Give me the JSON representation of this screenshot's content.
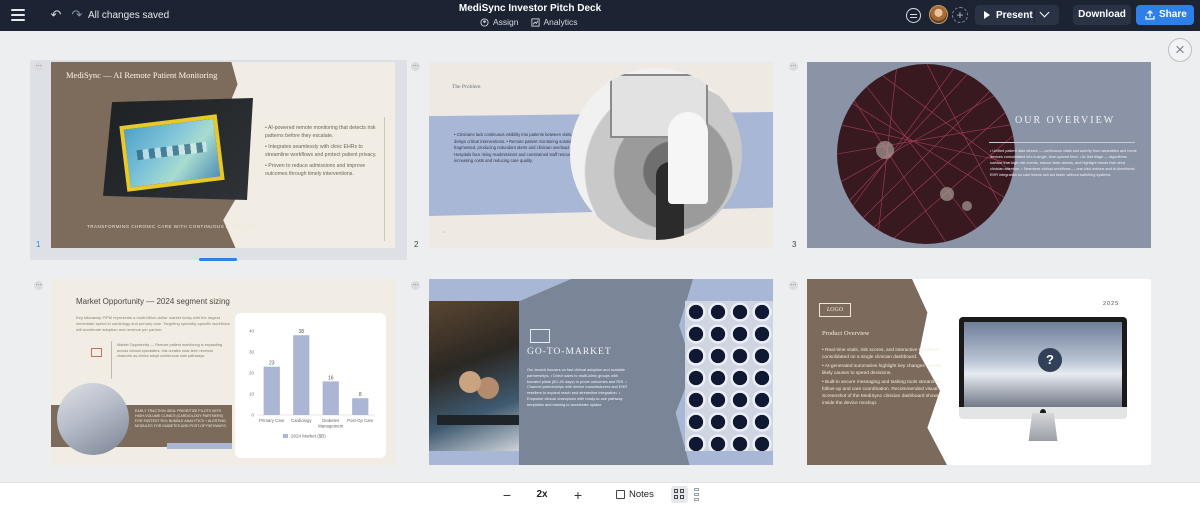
{
  "topbar": {
    "saved_status": "All changes saved",
    "title": "MediSync Investor Pitch Deck",
    "assign_label": "Assign",
    "analytics_label": "Analytics",
    "present_label": "Present",
    "download_label": "Download",
    "share_label": "Share",
    "share_color": "#2f7fe8",
    "bar_color": "#1c2433"
  },
  "close_icon": "×",
  "slides": [
    {
      "number": "1",
      "title": "MediSync — AI Remote Patient Monitoring",
      "bullets": [
        "• AI-powered remote monitoring that detects risk patterns before they escalate.",
        "• Integrates seamlessly with clinic EHRs to streamline workflows and protect patient privacy.",
        "• Proven to reduce admissions and improve outcomes through timely interventions."
      ],
      "footer": "Transforming chronic care with continuous AI insights.",
      "selected": true
    },
    {
      "number": "2",
      "label": "The Problem",
      "bullets": "• Clinicians lack continuous visibility into patients between visits, which delays critical interventions. • Remote patient monitoring solutions are fragmented, producing redundant alerts and clinician overload. • Hospitals face rising readmissions and constrained staff resources, increasing costs and reducing care quality."
    },
    {
      "number": "3",
      "heading": "OUR OVERVIEW",
      "bullets": "• Unified patient data stream — continuous vitals and activity from wearables and home devices consolidated into a single, time-synced feed. • AI-first triage — algorithms surface true high-risk events, reduce false alarms, and highlight trends that need clinician attention. • Seamless clinical workflows — one-click actions and bi-directional EHR integration so care teams can act faster without switching systems."
    },
    {
      "number": "",
      "title": "Market Opportunity — 2024 segment sizing",
      "intro": "Key takeaway: RPM represents a multi-billion-dollar market today with the largest immediate spend in cardiology and primary care. Targeting specialty-specific workflows will accelerate adoption and revenue per partner.",
      "opportunity": "Market Opportunity — Remote patient monitoring is expanding across clinical specialties; this creates near-term revenue channels as clinics adopt continuous care pathways.",
      "callout": "Early traction idea: Prioritize pilots with high-volume clinics (cardiology partners) for fastest ROI; bundle analytics + alerting modules for diabetes and post-op pathways."
    },
    {
      "number": "",
      "heading": "GO-TO-MARKET",
      "body": "Our launch focuses on fast clinical adoption and scalable partnerships. • Direct sales to multi-clinic groups with focused pilots (60–90 days) to prove outcomes and ROI. • Channel partnerships with device manufacturers and EHR resellers to expand reach and streamline integration. • Empower clinical champions with ready-to-use pathway templates and training to accelerate uptake."
    },
    {
      "number": "",
      "logo": "LOGO",
      "year": "2025",
      "title": "Product Overview",
      "bullets": [
        "• Real-time vitals, risk scores, and interactive trendlines consolidated on a single clinician dashboard.",
        "• AI-generated summaries highlight key changes and the likely causes to speed decisions.",
        "• Built-in secure messaging and tasking tools streamline follow-up and care coordination. Recommended visual: Screenshot of the MediSync clinician dashboard shown inside the device mockup."
      ],
      "placeholder": "?"
    }
  ],
  "chart_data": {
    "type": "bar",
    "categories": [
      "Primary Care",
      "Cardiology",
      "Diabetes Management",
      "Post-Op Care"
    ],
    "values": [
      23,
      38,
      16,
      8
    ],
    "value_labels": [
      "23",
      "38",
      "16",
      "8"
    ],
    "yticks": [
      "0",
      "10",
      "20",
      "30",
      "40"
    ],
    "ylim": [
      0,
      40
    ],
    "series": [
      {
        "name": "2024 Market ($B)",
        "values": [
          23,
          38,
          16,
          8
        ]
      }
    ],
    "bar_color": "#aab6d4"
  },
  "bottombar": {
    "zoom": "2x",
    "notes_label": "Notes"
  }
}
